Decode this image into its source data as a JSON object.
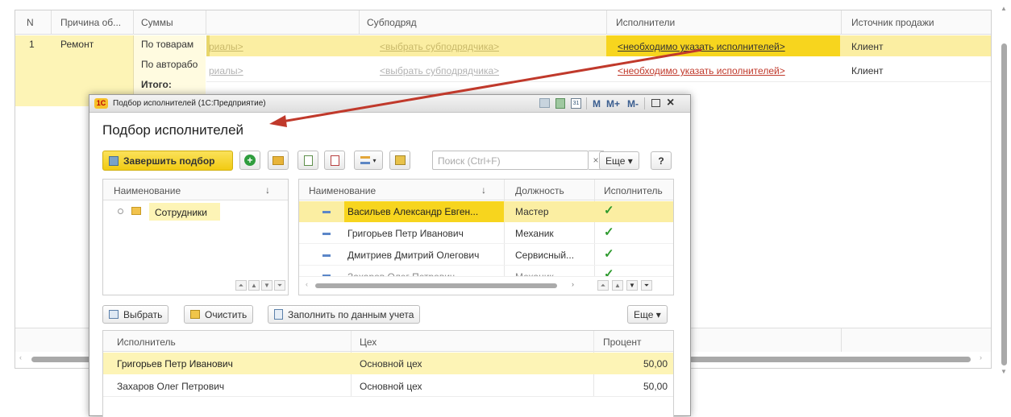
{
  "bg_table": {
    "columns": [
      "N",
      "Причина об...",
      "Суммы",
      "",
      "Субподряд",
      "Исполнители",
      "Источник продажи"
    ],
    "row_n": "1",
    "row_reason": "Ремонт",
    "sums": [
      "По товарам",
      "По авторабо",
      "Итого:"
    ],
    "row1": {
      "materials": "риалы>",
      "sub": "<выбрать субподрядчика>",
      "exec": "<необходимо указать исполнителей>",
      "source": "Клиент"
    },
    "row2": {
      "materials": "риалы>",
      "sub": "<выбрать субподрядчика>",
      "exec": "<необходимо указать исполнителей>",
      "source": "Клиент"
    }
  },
  "dialog": {
    "window_title": "Подбор исполнителей (1С:Предприятие)",
    "window_controls": [
      "M",
      "M+",
      "M-"
    ],
    "title": "Подбор исполнителей",
    "finish_button": "Завершить подбор",
    "search_placeholder": "Поиск (Ctrl+F)",
    "search_clear": "×",
    "more_button": "Еще ▾",
    "help_button": "?",
    "tree": {
      "header": "Наименование",
      "sort": "↓",
      "items": [
        {
          "label": "Сотрудники"
        }
      ]
    },
    "list": {
      "headers": {
        "name": "Наименование",
        "sort": "↓",
        "position": "Должность",
        "executor": "Исполнитель"
      },
      "rows": [
        {
          "name": "Васильев Александр Евген...",
          "position": "Мастер",
          "executor": "✓"
        },
        {
          "name": "Григорьев Петр Иванович",
          "position": "Механик",
          "executor": "✓"
        },
        {
          "name": "Дмитриев Дмитрий Олегович",
          "position": "Сервисный...",
          "executor": "✓"
        },
        {
          "name": "Захаров Олег Петрович",
          "position": "Механик",
          "executor": "✓"
        }
      ]
    },
    "bottom_toolbar": {
      "select": "Выбрать",
      "clear": "Очистить",
      "fill": "Заполнить по данным учета",
      "more": "Еще ▾"
    },
    "selected": {
      "headers": {
        "executor": "Исполнитель",
        "shop": "Цех",
        "percent": "Процент"
      },
      "rows": [
        {
          "executor": "Григорьев Петр Иванович",
          "shop": "Основной цех",
          "percent": "50,00"
        },
        {
          "executor": "Захаров Олег Петрович",
          "shop": "Основной цех",
          "percent": "50,00"
        }
      ]
    }
  },
  "colors": {
    "highlight": "#fbeea2",
    "selected_row": "#fdf4b6",
    "finish_button": "#f7d51e",
    "arrow": "#c0392b"
  }
}
